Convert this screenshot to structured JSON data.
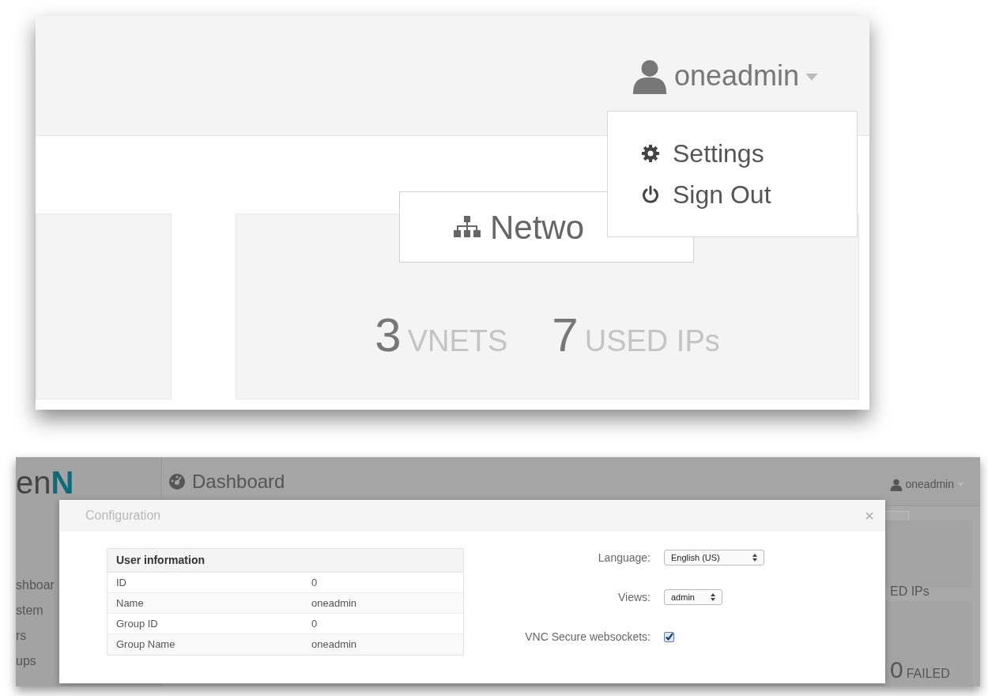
{
  "top": {
    "user": {
      "name": "oneadmin"
    },
    "menu": [
      {
        "label": "Settings"
      },
      {
        "label": "Sign Out"
      }
    ],
    "network": {
      "title": "Netwo",
      "stats": [
        {
          "count": "3",
          "unit": "VNETS"
        },
        {
          "count": "7",
          "unit": "USED IPs"
        }
      ]
    }
  },
  "bottom": {
    "logo": {
      "prefix": "en",
      "accent": "N"
    },
    "sidebar": {
      "items": [
        "shboar",
        "stem",
        "rs",
        "ups"
      ]
    },
    "header": {
      "title": "Dashboard",
      "user": "oneadmin"
    },
    "background": {
      "label": "ED IPs",
      "failed_value": "0",
      "failed_label": "FAILED"
    },
    "modal": {
      "title": "Configuration",
      "close": "×",
      "table": {
        "heading": "User information",
        "rows": [
          [
            "ID",
            "0"
          ],
          [
            "Name",
            "oneadmin"
          ],
          [
            "Group ID",
            "0"
          ],
          [
            "Group Name",
            "oneadmin"
          ]
        ]
      },
      "settings": [
        {
          "kind": "select",
          "label": "Language:",
          "value": "English (US)"
        },
        {
          "kind": "select",
          "label": "Views:",
          "value": "admin"
        },
        {
          "kind": "checkbox",
          "label": "VNC Secure websockets:",
          "checked": true
        }
      ]
    }
  }
}
